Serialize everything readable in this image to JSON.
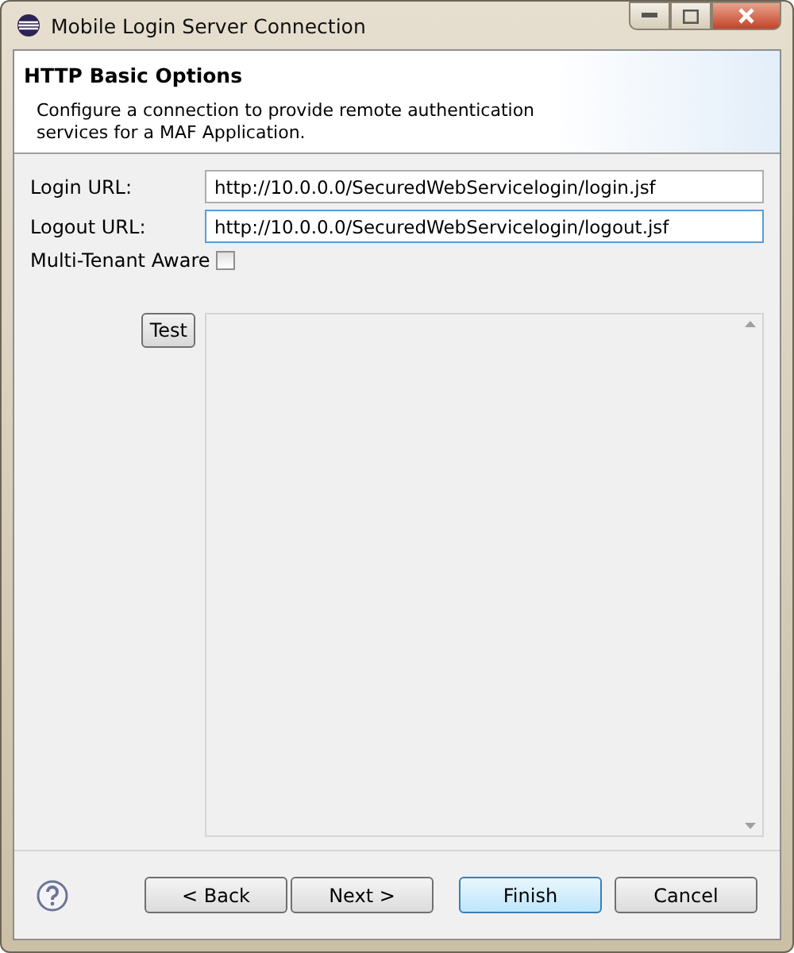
{
  "window": {
    "title": "Mobile Login Server Connection"
  },
  "header": {
    "title": "HTTP Basic Options",
    "description": "Configure a connection to provide remote authentication services for a MAF Application."
  },
  "fields": [
    {
      "label": "Login URL:",
      "value": "http://10.0.0.0/SecuredWebServicelogin/login.jsf",
      "focused": false
    },
    {
      "label": "Logout URL:",
      "value": "http://10.0.0.0/SecuredWebServicelogin/logout.jsf",
      "focused": true
    }
  ],
  "multi_tenant": {
    "label": "Multi-Tenant Aware",
    "checked": false
  },
  "test_button": {
    "label": "Test"
  },
  "buttons": [
    {
      "label": "< Back",
      "default": false
    },
    {
      "label": "Next >",
      "default": false
    },
    {
      "label": "Finish",
      "default": true
    },
    {
      "label": "Cancel",
      "default": false
    }
  ]
}
